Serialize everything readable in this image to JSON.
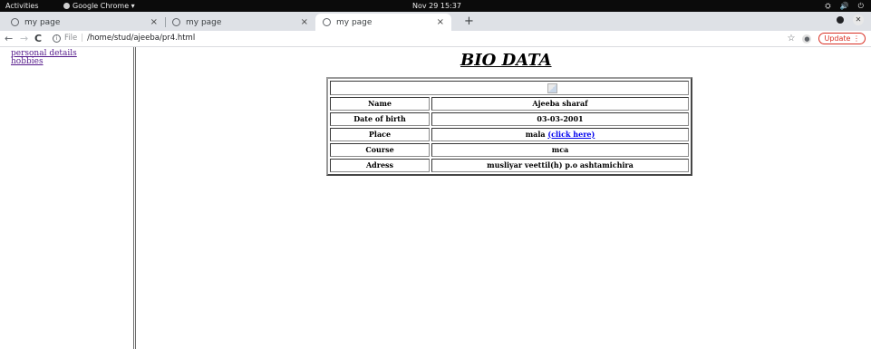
{
  "system_bar": {
    "activities": "Activities",
    "app_name": "Google Chrome ▾",
    "clock": "Nov 29  15:37"
  },
  "tabs": [
    {
      "label": "my page",
      "close": "×"
    },
    {
      "label": "my page",
      "close": "×"
    },
    {
      "label": "my page",
      "close": "×"
    }
  ],
  "new_tab": "+",
  "address_bar": {
    "scheme": "File",
    "separator": "|",
    "path": "/home/stud/ajeeba/pr4.html",
    "update_label": "Update"
  },
  "sidebar_links": [
    {
      "label": "personal details"
    },
    {
      "label": "hobbies"
    }
  ],
  "page": {
    "title": "BIO DATA",
    "rows": [
      {
        "label": "Name",
        "value": "Ajeeba sharaf"
      },
      {
        "label": "Date of birth",
        "value": "03-03-2001"
      },
      {
        "label": "Place",
        "value": "mala",
        "link": "(click here)"
      },
      {
        "label": "Course",
        "value": "mca"
      },
      {
        "label": "Adress",
        "value": "musliyar veettil(h) p.o ashtamichira"
      }
    ]
  },
  "icons": {
    "back": "arrow-left-icon",
    "forward": "arrow-right-icon",
    "reload": "reload-icon",
    "info": "info-icon",
    "star": "star-icon",
    "profile": "profile-icon",
    "broken_image": "broken-image-icon"
  }
}
